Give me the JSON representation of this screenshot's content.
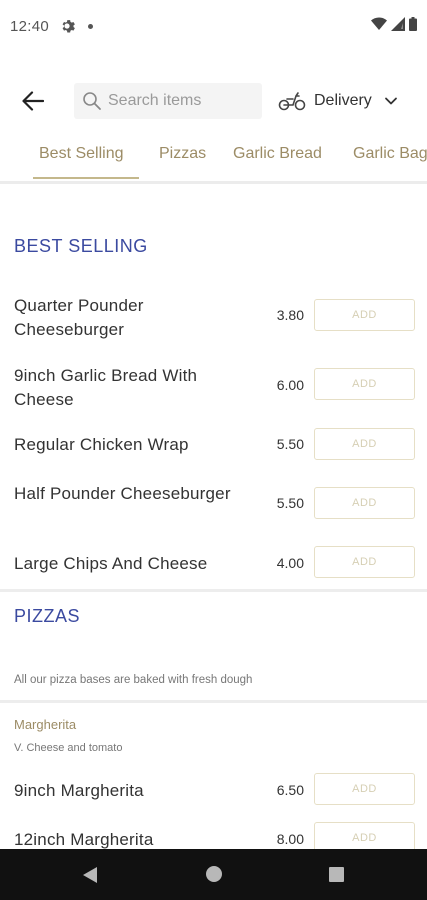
{
  "status_bar": {
    "time": "12:40"
  },
  "header": {
    "search_placeholder": "Search items",
    "delivery_label": "Delivery"
  },
  "tabs": [
    {
      "label": "Best Selling",
      "active": true
    },
    {
      "label": "Pizzas",
      "active": false
    },
    {
      "label": "Garlic Bread",
      "active": false
    },
    {
      "label": "Garlic Bag",
      "active": false
    }
  ],
  "sections": {
    "best_selling": {
      "title": "BEST SELLING",
      "items": [
        {
          "name": "Quarter Pounder Cheeseburger",
          "price": "3.80",
          "add_label": "ADD"
        },
        {
          "name": "9inch Garlic Bread With Cheese",
          "price": "6.00",
          "add_label": "ADD"
        },
        {
          "name": "Regular Chicken Wrap",
          "price": "5.50",
          "add_label": "ADD"
        },
        {
          "name": "Half Pounder Cheeseburger",
          "price": "5.50",
          "add_label": "ADD"
        },
        {
          "name": "Large Chips And Cheese",
          "price": "4.00",
          "add_label": "ADD"
        }
      ]
    },
    "pizzas": {
      "title": "PIZZAS",
      "note": "All our pizza bases are baked with fresh dough",
      "category": "Margherita",
      "category_desc": "V. Cheese and tomato",
      "items": [
        {
          "name": "9inch Margherita",
          "price": "6.50",
          "add_label": "ADD"
        },
        {
          "name": "12inch Margherita",
          "price": "8.00",
          "add_label": "ADD"
        }
      ]
    }
  },
  "colors": {
    "accent_gold": "#9c8c66",
    "section_blue": "#3b4aa0",
    "button_border": "#e6dfc6"
  }
}
